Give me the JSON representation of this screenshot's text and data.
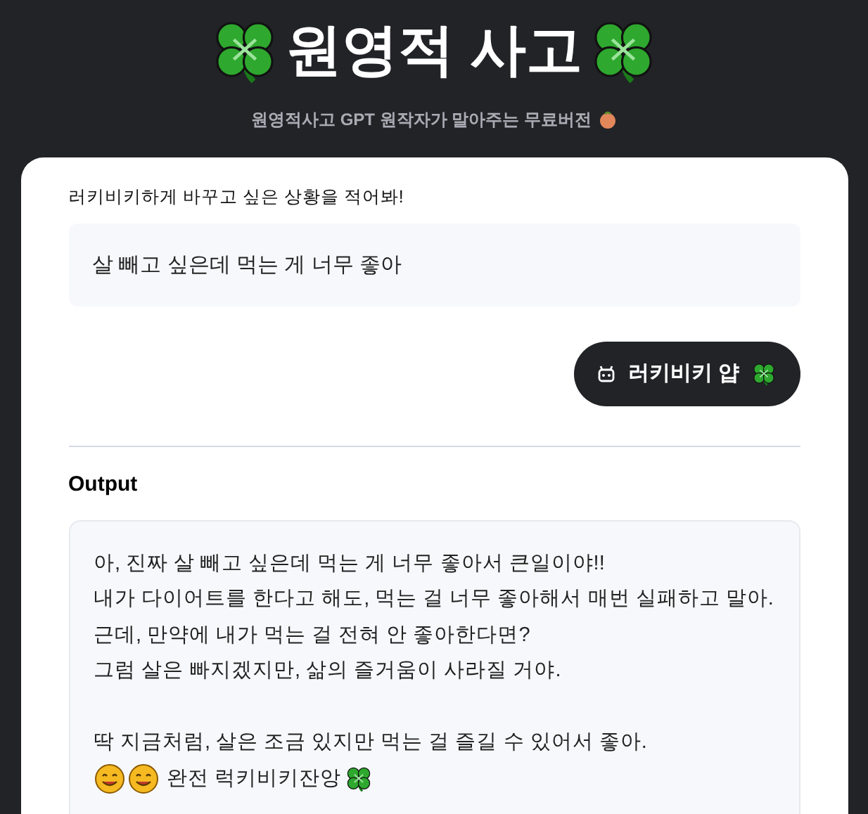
{
  "header": {
    "title": "원영적 사고",
    "subtitle": "원영적사고 GPT 원작자가 말아주는 무료버전"
  },
  "form": {
    "label": "러키비키하게 바꾸고 싶은 상황을 적어봐!",
    "value": "살 빼고 싶은데 먹는 게 너무 좋아",
    "button": "러키비키 얍"
  },
  "output": {
    "title": "Output",
    "paragraphs": [
      {
        "lines": [
          "아, 진짜 살 빼고 싶은데 먹는 게 너무 좋아서 큰일이야!!",
          "내가 다이어트를 한다고 해도, 먹는 걸 너무 좋아해서 매번 실패하고 말아.",
          "근데, 만약에 내가 먹는 걸 전혀 안 좋아한다면?",
          "그럼 살은 빠지겠지만, 삶의 즐거움이 사라질 거야."
        ]
      },
      {
        "lines": [
          "딱 지금처럼, 살은 조금 있지만 먹는 걸 즐길 수 있어서 좋아."
        ]
      }
    ],
    "sign_off": "완전 럭키비키잔앙"
  }
}
